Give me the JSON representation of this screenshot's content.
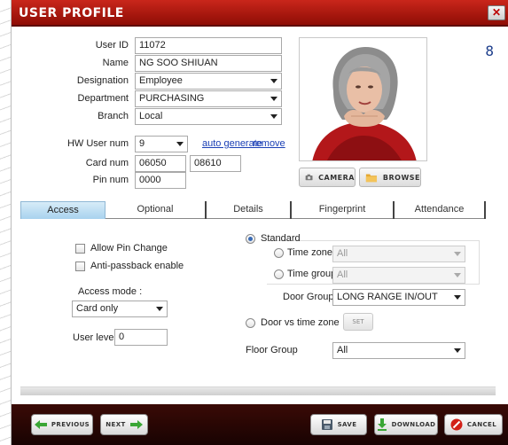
{
  "window": {
    "title": "USER PROFILE",
    "close_label": "✕"
  },
  "record_counter": "8",
  "profile": {
    "user_id_label": "User ID",
    "user_id": "11072",
    "name_label": "Name",
    "name": "NG SOO SHIUAN",
    "designation_label": "Designation",
    "designation": "Employee",
    "department_label": "Department",
    "department": "PURCHASING",
    "branch_label": "Branch",
    "branch": "Local",
    "hw_user_num_label": "HW User num",
    "hw_user_num": "9",
    "auto_generate": "auto generate",
    "remove": "remove",
    "card_num_label": "Card num",
    "card_num_1": "06050",
    "card_num_2": "08610",
    "pin_num_label": "Pin num",
    "pin_num": "0000"
  },
  "photo_buttons": {
    "camera": "CAMERA",
    "browse": "BROWSE"
  },
  "tabs": [
    {
      "label": "Access",
      "active": true
    },
    {
      "label": "Optional"
    },
    {
      "label": "Details"
    },
    {
      "label": "Fingerprint"
    },
    {
      "label": "Attendance"
    }
  ],
  "access": {
    "allow_pin_change": "Allow Pin Change",
    "anti_passback": "Anti-passback enable",
    "access_mode_label": "Access mode :",
    "access_mode": "Card only",
    "user_level_label": "User level",
    "user_level": "0",
    "standard": "Standard",
    "time_zone_label": "Time zone",
    "time_zone": "All",
    "time_group_label": "Time group",
    "time_group": "All",
    "door_group_label": "Door Group",
    "door_group": "LONG RANGE IN/OUT",
    "door_vs_time_zone": "Door vs time zone",
    "set_label": "SET",
    "floor_group_label": "Floor Group",
    "floor_group": "All"
  },
  "footer": {
    "previous": "PREVIOUS",
    "next": "NEXT",
    "save": "SAVE",
    "download": "DOWNLOAD",
    "cancel": "CANCEL"
  },
  "colors": {
    "titlebar": "#b01a10",
    "footer": "#2a0604",
    "active_tab": "#bfe0f4"
  }
}
